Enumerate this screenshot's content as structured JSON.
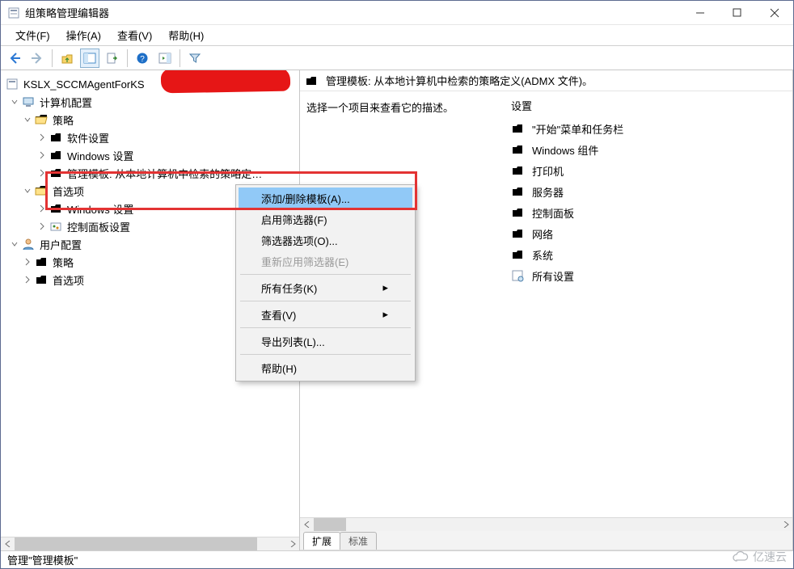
{
  "title": "组策略管理编辑器",
  "menu": {
    "file": "文件(F)",
    "action": "操作(A)",
    "view": "查看(V)",
    "help": "帮助(H)"
  },
  "tree": {
    "root": "KSLX_SCCMAgentForKS",
    "computer_config": "计算机配置",
    "policy": "策略",
    "soft_settings": "软件设置",
    "win_settings": "Windows 设置",
    "admin_templates": "管理模板: 从本地计算机中检索的策略定…",
    "preferences": "首选项",
    "pref_win_settings": "Windows 设置",
    "pref_ctrlp": "控制面板设置",
    "user_config": "用户配置",
    "user_policy": "策略",
    "user_pref": "首选项"
  },
  "context_menu": {
    "add_remove": "添加/删除模板(A)...",
    "enable_filter": "启用筛选器(F)",
    "filter_opts": "筛选器选项(O)...",
    "reapply_filter": "重新应用筛选器(E)",
    "all_tasks": "所有任务(K)",
    "view": "查看(V)",
    "export_list": "导出列表(L)...",
    "help": "帮助(H)"
  },
  "details": {
    "header": "管理模板: 从本地计算机中检索的策略定义(ADMX 文件)。",
    "desc": "选择一个项目来查看它的描述。",
    "settings_hdr": "设置",
    "items": [
      "\"开始\"菜单和任务栏",
      "Windows 组件",
      "打印机",
      "服务器",
      "控制面板",
      "网络",
      "系统",
      "所有设置"
    ]
  },
  "tabs": {
    "ext": "扩展",
    "std": "标准"
  },
  "statusbar": "管理\"管理模板\"",
  "watermark": "亿速云"
}
